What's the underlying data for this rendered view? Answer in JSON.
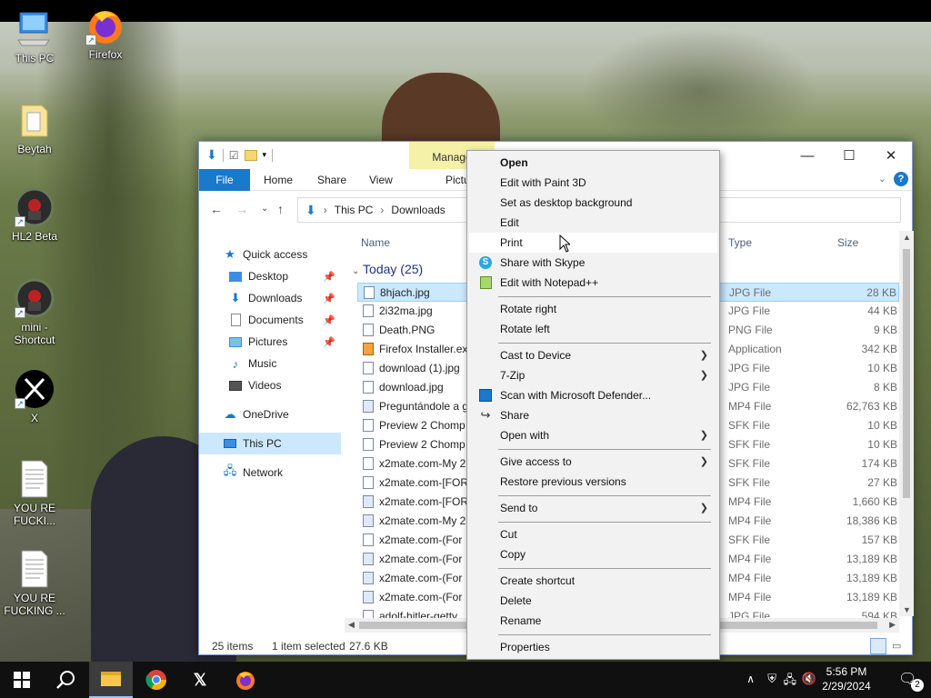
{
  "desktop": {
    "icons": [
      {
        "label": "This PC"
      },
      {
        "label": "Firefox"
      },
      {
        "label": "Beytah"
      },
      {
        "label": "HL2 Beta"
      },
      {
        "label": "mini - Shortcut"
      },
      {
        "label": "X"
      },
      {
        "label": "YOU RE FUCKI..."
      },
      {
        "label": "YOU RE FUCKING ..."
      }
    ]
  },
  "explorer": {
    "manage_tab": "Manage",
    "ribbon_tabs": {
      "file": "File",
      "home": "Home",
      "share": "Share",
      "view": "View",
      "picture_tools": "Picture Tools"
    },
    "breadcrumb": {
      "root": "This PC",
      "folder": "Downloads"
    },
    "nav": {
      "quick_access": "Quick access",
      "desktop": "Desktop",
      "downloads": "Downloads",
      "documents": "Documents",
      "pictures": "Pictures",
      "music": "Music",
      "videos": "Videos",
      "onedrive": "OneDrive",
      "this_pc": "This PC",
      "network": "Network"
    },
    "columns": {
      "name": "Name",
      "type": "Type",
      "size": "Size"
    },
    "group_label": "Today (25)",
    "files": [
      {
        "name": "8hjach.jpg",
        "type": "JPG File",
        "size": "28 KB"
      },
      {
        "name": "2i32ma.jpg",
        "type": "JPG File",
        "size": "44 KB"
      },
      {
        "name": "Death.PNG",
        "type": "PNG File",
        "size": "9 KB"
      },
      {
        "name": "Firefox Installer.exe",
        "type": "Application",
        "size": "342 KB"
      },
      {
        "name": "download (1).jpg",
        "type": "JPG File",
        "size": "10 KB"
      },
      {
        "name": "download.jpg",
        "type": "JPG File",
        "size": "8 KB"
      },
      {
        "name": "Preguntándole a g",
        "type": "MP4 File",
        "size": "62,763 KB"
      },
      {
        "name": "Preview 2 Chomp",
        "type": "SFK File",
        "size": "10 KB"
      },
      {
        "name": "Preview 2 Chomp",
        "type": "SFK File",
        "size": "10 KB"
      },
      {
        "name": "x2mate.com-My 2",
        "type": "SFK File",
        "size": "174 KB"
      },
      {
        "name": "x2mate.com-[FOR",
        "type": "SFK File",
        "size": "27 KB"
      },
      {
        "name": "x2mate.com-[FOR",
        "type": "MP4 File",
        "size": "1,660 KB"
      },
      {
        "name": "x2mate.com-My 2",
        "type": "MP4 File",
        "size": "18,386 KB"
      },
      {
        "name": "x2mate.com-(For",
        "type": "SFK File",
        "size": "157 KB"
      },
      {
        "name": "x2mate.com-(For",
        "type": "MP4 File",
        "size": "13,189 KB"
      },
      {
        "name": "x2mate.com-(For",
        "type": "MP4 File",
        "size": "13,189 KB"
      },
      {
        "name": "x2mate.com-(For",
        "type": "MP4 File",
        "size": "13,189 KB"
      },
      {
        "name": "adolf-hitler-getty",
        "type": "JPG File",
        "size": "594 KB"
      }
    ],
    "status": {
      "items": "25 items",
      "selected": "1 item selected",
      "size": "27.6 KB"
    }
  },
  "context_menu": {
    "items": [
      {
        "label": "Open"
      },
      {
        "label": "Edit with Paint 3D"
      },
      {
        "label": "Set as desktop background"
      },
      {
        "label": "Edit"
      },
      {
        "label": "Print"
      },
      {
        "label": "Share with Skype"
      },
      {
        "label": "Edit with Notepad++"
      },
      {
        "label": "Rotate right"
      },
      {
        "label": "Rotate left"
      },
      {
        "label": "Cast to Device"
      },
      {
        "label": "7-Zip"
      },
      {
        "label": "Scan with Microsoft Defender..."
      },
      {
        "label": "Share"
      },
      {
        "label": "Open with"
      },
      {
        "label": "Give access to"
      },
      {
        "label": "Restore previous versions"
      },
      {
        "label": "Send to"
      },
      {
        "label": "Cut"
      },
      {
        "label": "Copy"
      },
      {
        "label": "Create shortcut"
      },
      {
        "label": "Delete"
      },
      {
        "label": "Rename"
      },
      {
        "label": "Properties"
      }
    ]
  },
  "taskbar": {
    "time": "5:56 PM",
    "date": "2/29/2024",
    "notification_count": "2"
  },
  "colors": {
    "accent": "#1979ca",
    "selection": "#cce8ff",
    "taskbar": "#101010"
  }
}
